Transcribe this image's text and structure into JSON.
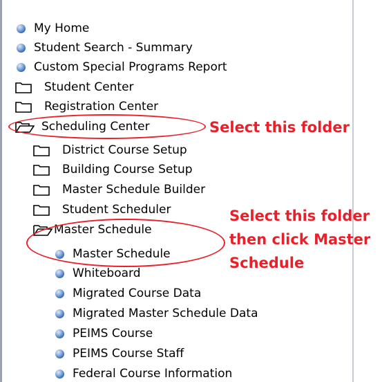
{
  "tree": {
    "items": [
      {
        "label": "My Home"
      },
      {
        "label": "Student Search - Summary"
      },
      {
        "label": "Custom Special Programs Report"
      },
      {
        "label": "Student Center"
      },
      {
        "label": "Registration Center"
      },
      {
        "label": "Scheduling Center"
      },
      {
        "label": "District Course Setup"
      },
      {
        "label": "Building Course Setup"
      },
      {
        "label": "Master Schedule Builder"
      },
      {
        "label": "Student Scheduler"
      },
      {
        "label": "Master Schedule"
      },
      {
        "label": "Master Schedule"
      },
      {
        "label": "Whiteboard"
      },
      {
        "label": "Migrated Course Data"
      },
      {
        "label": "Migrated Master Schedule Data"
      },
      {
        "label": "PEIMS Course"
      },
      {
        "label": "PEIMS Course Staff"
      },
      {
        "label": "Federal Course Information"
      }
    ]
  },
  "annotations": {
    "note1": "Select this folder",
    "note2_line1": "Select this folder",
    "note2_line2": "then click Master",
    "note2_line3": "Schedule",
    "color": "#e8202a"
  }
}
